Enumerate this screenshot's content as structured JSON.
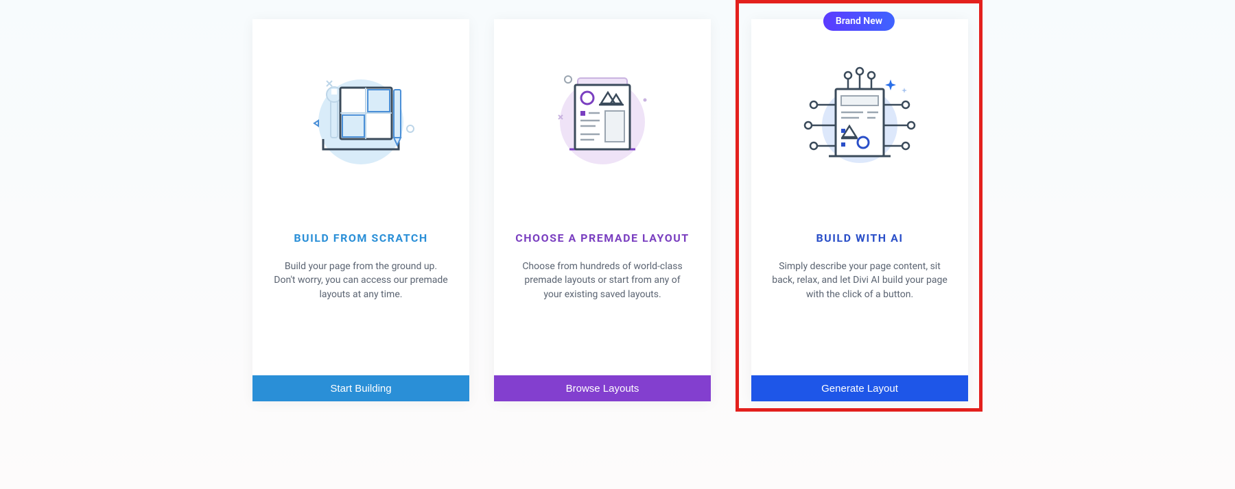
{
  "cards": [
    {
      "title": "BUILD FROM SCRATCH",
      "description": "Build your page from the ground up. Don't worry, you can access our premade layouts at any time.",
      "button": "Start Building"
    },
    {
      "title": "CHOOSE A PREMADE LAYOUT",
      "description": "Choose from hundreds of world-class premade layouts or start from any of your existing saved layouts.",
      "button": "Browse Layouts"
    },
    {
      "title": "BUILD WITH AI",
      "description": "Simply describe your page content, sit back, relax, and let Divi AI build your page with the click of a button.",
      "button": "Generate Layout",
      "badge": "Brand New"
    }
  ]
}
